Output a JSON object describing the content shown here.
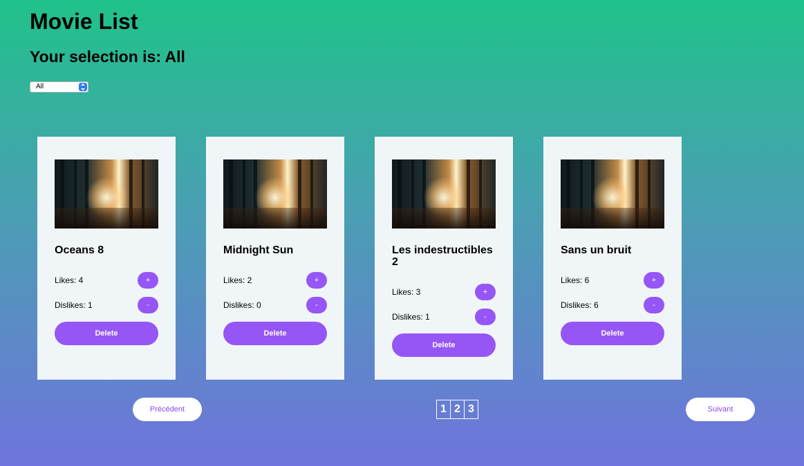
{
  "header": {
    "title": "Movie List",
    "selection": "Your selection is: All"
  },
  "filter": {
    "selected": "All",
    "accent": "#2f7cf6"
  },
  "movies": [
    {
      "title": "Oceans 8",
      "likes": "Likes: 4",
      "dislikes": "Dislikes: 1",
      "like_btn": "+",
      "dislike_btn": "-",
      "delete": "Delete"
    },
    {
      "title": "Midnight Sun",
      "likes": "Likes: 2",
      "dislikes": "Dislikes: 0",
      "like_btn": "+",
      "dislike_btn": "-",
      "delete": "Delete"
    },
    {
      "title": "Les indestructibles 2",
      "likes": "Likes: 3",
      "dislikes": "Dislikes: 1",
      "like_btn": "+",
      "dislike_btn": "-",
      "delete": "Delete"
    },
    {
      "title": "Sans un bruit",
      "likes": "Likes: 6",
      "dislikes": "Dislikes: 6",
      "like_btn": "+",
      "dislike_btn": "-",
      "delete": "Delete"
    }
  ],
  "pagination": {
    "previous": "Précédent",
    "next": "Suivant",
    "pages": [
      "1",
      "2",
      "3"
    ]
  },
  "colors": {
    "accent": "#9656f5",
    "card": "#f0f5f8",
    "gradient_top": "#20c28a",
    "gradient_bottom": "#6f74dc"
  }
}
